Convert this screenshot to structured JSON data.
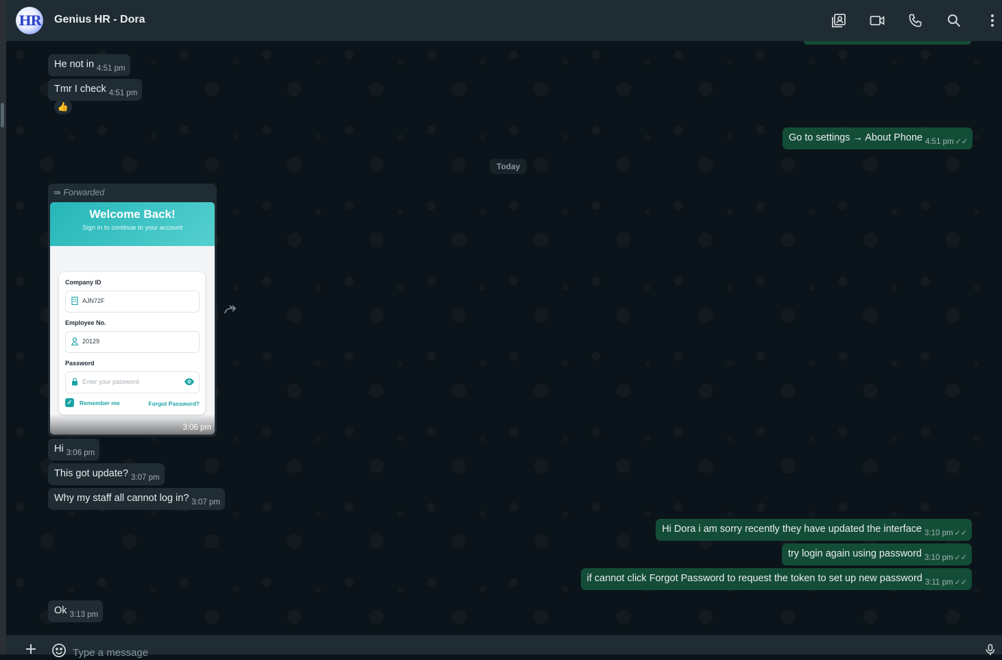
{
  "header": {
    "avatar_text": "HR",
    "contact_name": "Genius HR - Dora"
  },
  "messages": [
    {
      "text": "He not in",
      "time": "4:51 pm"
    },
    {
      "text": "Tmr I check",
      "time": "4:51 pm"
    },
    {
      "text": "Go to settings → About Phone",
      "time": "4:51 pm",
      "ticks": "✓✓"
    },
    {
      "text": "Hi",
      "time": "3:06 pm"
    },
    {
      "text": "This got update?",
      "time": "3:07 pm"
    },
    {
      "text": "Why my staff all cannot log in?",
      "time": "3:07 pm"
    },
    {
      "text": "Hi Dora i am sorry recently they have updated the interface",
      "time": "3:10 pm",
      "ticks": "✓✓"
    },
    {
      "text": "try login again using password",
      "time": "3:10 pm",
      "ticks": "✓✓"
    },
    {
      "text": "if cannot click Forgot Password to request the token to set up new password",
      "time": "3:11 pm",
      "ticks": "✓✓"
    },
    {
      "text": "Ok",
      "time": "3:13 pm"
    }
  ],
  "reaction": "👍",
  "date_divider": "Today",
  "forwarded": {
    "label": "Forwarded",
    "time": "3:06 pm",
    "screenshot": {
      "title": "Welcome Back!",
      "subtitle": "Sign in to continue to your account",
      "company_label": "Company ID",
      "company_value": "AJN72F",
      "employee_label": "Employee No.",
      "employee_value": "20129",
      "password_label": "Password",
      "password_placeholder": "Enter your password",
      "remember": "Remember me",
      "forgot": "Forgot Password?"
    }
  },
  "composer": {
    "placeholder": "Type a message"
  },
  "icons": [
    "contact-card-icon",
    "video-call-icon",
    "phone-icon",
    "search-icon",
    "menu-icon",
    "forward-icon",
    "plus-icon",
    "emoji-icon",
    "mic-icon"
  ],
  "colors": {
    "background": "#0b141a",
    "header": "#202c33",
    "incoming": "#202c33",
    "outgoing": "#144d37",
    "accent": "#26b6b8"
  }
}
